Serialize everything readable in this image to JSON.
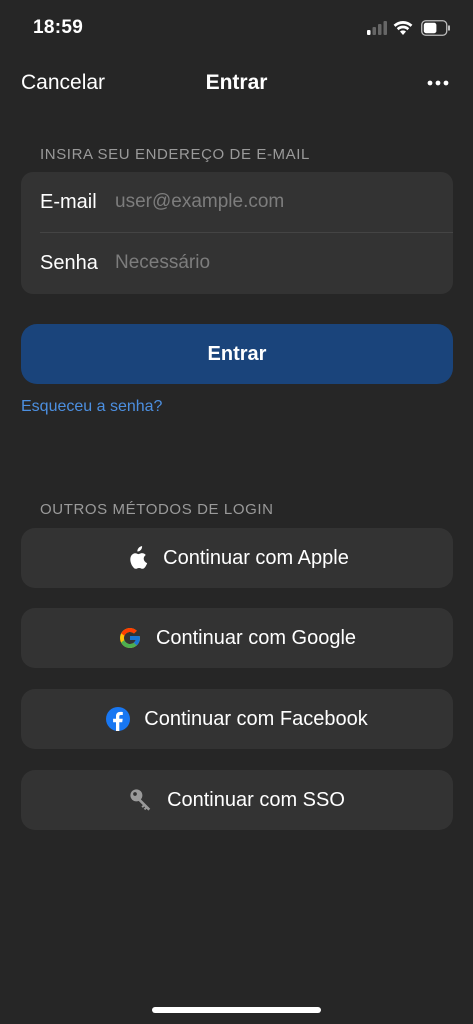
{
  "status_bar": {
    "time": "18:59",
    "battery_level": 0.6
  },
  "nav": {
    "cancel_label": "Cancelar",
    "title": "Entrar",
    "more_icon": "ellipsis-icon"
  },
  "email_section": {
    "header": "INSIRA SEU ENDEREÇO DE E-MAIL",
    "fields": [
      {
        "label": "E-mail",
        "value": "",
        "placeholder": "user@example.com"
      },
      {
        "label": "Senha",
        "value": "",
        "placeholder": "Necessário"
      }
    ]
  },
  "primary_button": {
    "label": "Entrar",
    "color": "#1a447b"
  },
  "forgot_link": "Esqueceu a senha?",
  "other_methods": {
    "header": "OUTROS MÉTODOS DE LOGIN",
    "buttons": [
      {
        "label": "Continuar com Apple",
        "icon": "apple-icon"
      },
      {
        "label": "Continuar com Google",
        "icon": "google-icon"
      },
      {
        "label": "Continuar com Facebook",
        "icon": "facebook-icon"
      },
      {
        "label": "Continuar com SSO",
        "icon": "key-icon"
      }
    ]
  },
  "colors": {
    "background": "#262626",
    "card": "#333333",
    "link": "#4c8fe0",
    "facebook_blue": "#1877f2"
  }
}
